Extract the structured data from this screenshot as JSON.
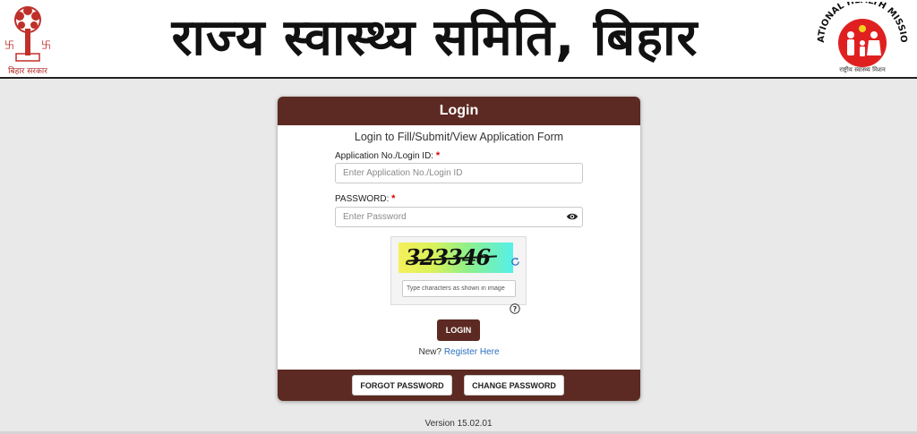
{
  "header": {
    "left_emblem_caption": "बिहार सरकार",
    "title": "राज्य स्वास्थ्य समिति, बिहार",
    "right_logo_name": "NATIONAL HEALTH MISSION",
    "right_logo_caption": "राष्ट्रीय स्वास्थ्य मिशन",
    "left_emblem_icon": "bodhi-tree-emblem-icon",
    "right_logo_icon": "family-health-logo-icon",
    "logo_color": "#e02020"
  },
  "login": {
    "title": "Login",
    "subtitle": "Login to Fill/Submit/View Application Form",
    "app_label": "Application No./Login ID:",
    "app_placeholder": "Enter Application No./Login ID",
    "app_value": "",
    "password_label": "PASSWORD:",
    "password_placeholder": "Enter Password",
    "password_value": "",
    "required_mark": "*",
    "captcha_text": "323346",
    "captcha_placeholder": "Type characters as shown in image",
    "login_button": "LOGIN",
    "new_text": "New?",
    "register_link": "Register Here",
    "forgot_button": "FORGOT PASSWORD",
    "change_button": "CHANGE PASSWORD",
    "accent_color": "#5c2a22"
  },
  "footer": {
    "version": "Version 15.02.01"
  }
}
